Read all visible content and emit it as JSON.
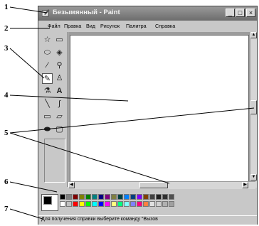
{
  "window": {
    "title": "Безымянный - Paint",
    "buttons": {
      "minimize": "_",
      "maximize": "□",
      "close": "×"
    }
  },
  "menu": [
    "Файл",
    "Правка",
    "Вид",
    "Рисунок",
    "Палитра",
    "Справка"
  ],
  "tools": [
    "free-select",
    "rect-select",
    "eraser",
    "fill",
    "color-picker",
    "magnifier",
    "pencil",
    "brush",
    "airbrush",
    "text",
    "line",
    "curve",
    "rectangle",
    "polygon",
    "ellipse",
    "rounded-rectangle"
  ],
  "tool_glyphs": [
    "☆",
    "▭",
    "⬭",
    "◈",
    "⁄",
    "⚲",
    "✎",
    "♙",
    "⚗",
    "A",
    "╲",
    "∫",
    "▭",
    "▱",
    "⬬",
    "▢"
  ],
  "palette": {
    "colors_row1": [
      "#000000",
      "#808080",
      "#800000",
      "#808000",
      "#008000",
      "#008080",
      "#000080",
      "#800080",
      "#808040",
      "#004040",
      "#0080ff",
      "#004080",
      "#8000ff",
      "#804000",
      "#404040",
      "#202020",
      "#303030",
      "#505050"
    ],
    "colors_row2": [
      "#ffffff",
      "#c0c0c0",
      "#ff0000",
      "#ffff00",
      "#00ff00",
      "#00ffff",
      "#0000ff",
      "#ff00ff",
      "#ffff80",
      "#00ff80",
      "#80ffff",
      "#8080ff",
      "#ff0080",
      "#ff8040",
      "#e0e0e0",
      "#d0d0d0",
      "#b0b0b0",
      "#a0a0a0"
    ]
  },
  "status": {
    "text": "Для получения справки выберите команду \"Вызов"
  },
  "callouts": [
    "1",
    "2",
    "3",
    "4",
    "5",
    "6",
    "7"
  ]
}
